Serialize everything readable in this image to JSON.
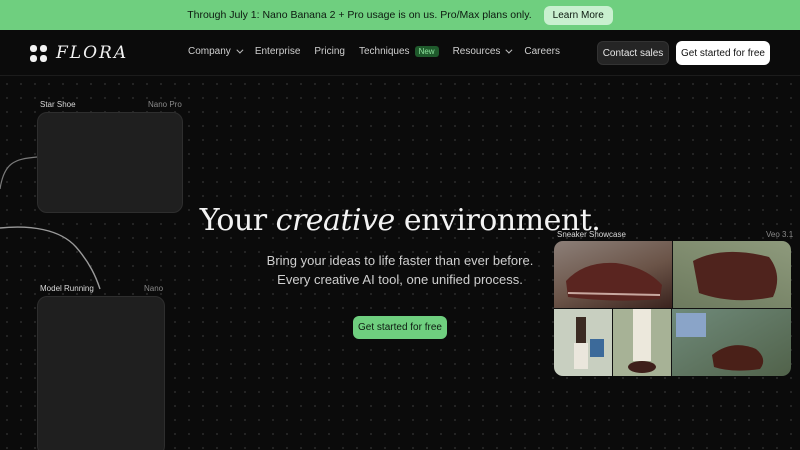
{
  "banner": {
    "text": "Through July 1: Nano Banana 2 + Pro usage is on us. Pro/Max plans only.",
    "button": "Learn More"
  },
  "nav": {
    "logo": "FLORA",
    "links": {
      "company": "Company",
      "enterprise": "Enterprise",
      "pricing": "Pricing",
      "techniques": "Techniques",
      "techniques_badge": "New",
      "resources": "Resources",
      "careers": "Careers"
    },
    "contact": "Contact sales",
    "cta": "Get started for free"
  },
  "nodes": [
    {
      "label": "Star Shoe",
      "model": "Nano Pro"
    },
    {
      "label": "Model Running",
      "model": "Nano"
    },
    {
      "label": "Sneaker Showcase",
      "model": "Veo 3.1"
    }
  ],
  "hero": {
    "title_prefix": "Your ",
    "title_emphasis": "creative",
    "title_suffix": " environment.",
    "subtitle_line1": "Bring your ideas to life faster than ever before.",
    "subtitle_line2": "Every creative AI tool, one unified process.",
    "cta": "Get started for free"
  },
  "colors": {
    "accent": "#6fcf7f",
    "background": "#0b0b0b"
  }
}
